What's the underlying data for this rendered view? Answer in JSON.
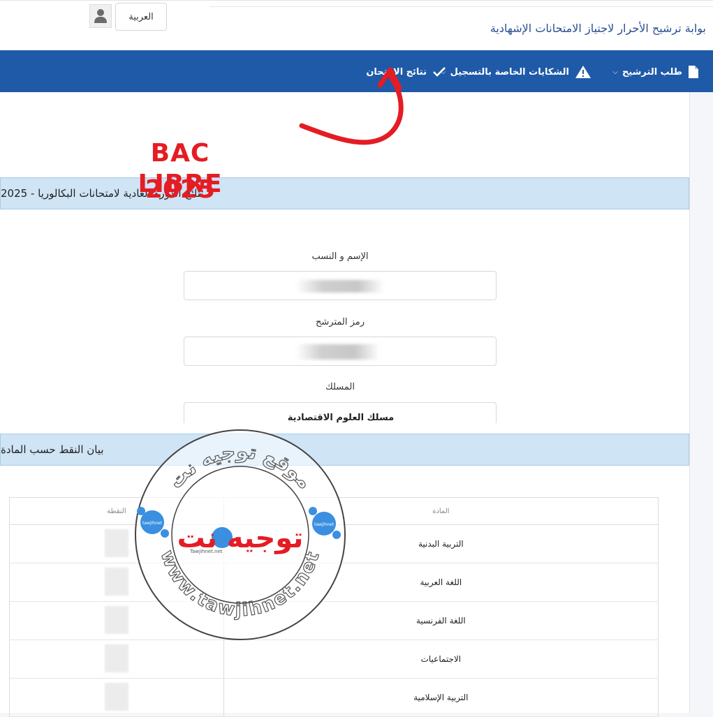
{
  "header": {
    "portal_title": "بوابة ترشيح الأحرار لاجتياز الامتحانات الإشهادية",
    "language_button": "العربية"
  },
  "nav": {
    "items": [
      {
        "label": "طلب الترشيح",
        "icon": "file-icon"
      },
      {
        "label": "الشكايات الخاصة بالتسجيل",
        "icon": "warning-icon"
      },
      {
        "label": "نتائج الامتحان",
        "icon": "check-icon"
      }
    ]
  },
  "annotation": {
    "line1": "BAC LIBRE",
    "line2": "2025",
    "color": "#e51c23"
  },
  "results_panel": {
    "title": "نتائج الدورة العادية لامتحانات البكالوريا - 2025",
    "name_label": "الإسم و النسب",
    "code_label": "رمز المترشح",
    "track_label": "المسلك",
    "track_value": "مسلك العلوم الاقتصادية"
  },
  "grades_panel": {
    "title": "بيان النقط حسب المادة",
    "columns": {
      "subject": "المادة",
      "grade": "النقطة"
    },
    "rows": [
      {
        "subject": "التربية البدنية"
      },
      {
        "subject": "اللغة العربية"
      },
      {
        "subject": "اللغة الفرنسية"
      },
      {
        "subject": "الاجتماعيات"
      },
      {
        "subject": "التربية الإسلامية"
      }
    ]
  },
  "watermark": {
    "arc_text": "موقع توجيه نت",
    "center_text": "توجيه نت",
    "url_text": "www.tawjihnet.net",
    "small_text": "Tawjihnet.net",
    "badge_text": "tawjihnet"
  },
  "colors": {
    "navbar": "#1f5aa8",
    "panel_header": "#cfe4f5",
    "title_blue": "#2a4f8f"
  }
}
